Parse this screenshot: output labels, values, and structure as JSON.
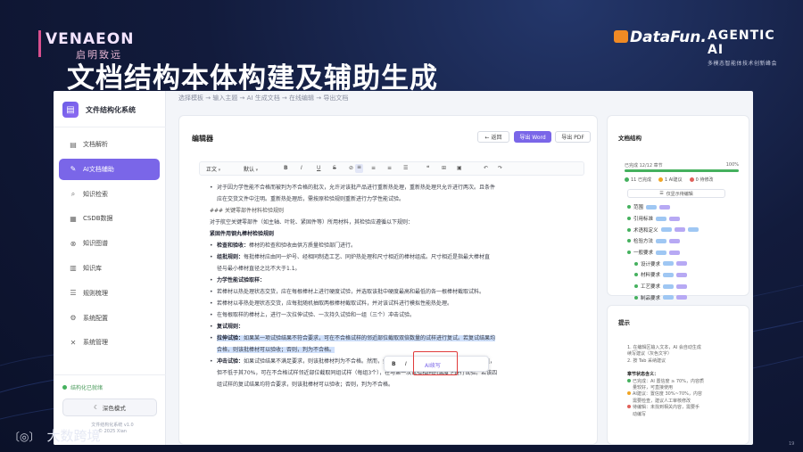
{
  "slide": {
    "brand_left_logo": "VENAEON",
    "brand_left_slogan": "启明致远",
    "brand_df": "DataFun.",
    "brand_agentic": "AGENTIC AI",
    "brand_agentic_sub": "多模态智能体技术创新峰会",
    "title": "文档结构本体构建及辅助生成",
    "bottom_logo": "大数跨境",
    "page_number": "19"
  },
  "app": {
    "breadcrumb": "选择模板 → 输入主题 → AI 生成文档 → 在线编辑 → 导出文档",
    "name": "文件结构化系统",
    "nav": [
      {
        "label": "文档解析",
        "icon": "document-icon"
      },
      {
        "label": "AI文档辅助",
        "icon": "ai-edit-icon"
      },
      {
        "label": "知识检索",
        "icon": "search-icon"
      },
      {
        "label": "CSDB数据",
        "icon": "database-icon"
      },
      {
        "label": "知识图谱",
        "icon": "graph-icon"
      },
      {
        "label": "知识库",
        "icon": "book-icon"
      },
      {
        "label": "规则梳理",
        "icon": "rules-icon"
      },
      {
        "label": "系统配置",
        "icon": "settings-icon"
      },
      {
        "label": "系统管理",
        "icon": "tools-icon"
      }
    ],
    "status": "结构化已就绪",
    "dark_mode": "深色模式",
    "version_line1": "文件结构化系统 v1.0",
    "version_line2": "© 2025 Xian"
  },
  "editor": {
    "title": "编辑器",
    "back": "← 返回",
    "export_word": "导出 Word",
    "export_pdf": "导出 PDF",
    "toolbar": {
      "style": "正文",
      "font": "默认",
      "bold": "B",
      "italic": "I",
      "underline": "U",
      "strike": "S",
      "link": "⊘",
      "align_left": "≡",
      "align_center": "≡",
      "align_right": "≡",
      "list": "☰",
      "quote": "❝",
      "table": "⊞",
      "image": "▣",
      "undo": "↶",
      "redo": "↷"
    },
    "lines": [
      {
        "t": "对于因力学性能不合格而被判为不合格的批次，允许对该批产品进行重新热处理，重新热处理只允许进行两次。且条件",
        "k": "bullet"
      },
      {
        "t": "应在交货文件中注明。重新热处理后，需按原检验规则重新进行力学性能试验。",
        "k": "cont"
      },
      {
        "t": "### 关键零部件材料检验规则",
        "k": "mono"
      },
      {
        "t": "对于航空关键零部件（如主轴、叶轮、紧固件等）所用材料，其检验应遵循以下规则：",
        "k": "plain"
      },
      {
        "t": "紧固件用钢丸棒材检验规则",
        "k": "head"
      },
      {
        "t": "检查和验收：棒材的检查和验收由供方质量检验部门进行。",
        "k": "bullet",
        "b": "检查和验收："
      },
      {
        "t": "组批规则：每批棒材应由同一炉号、经相同制造工艺、同炉热处理和尺寸相近的棒材组成。尺寸相近是指最大棒材直",
        "k": "bullet",
        "b": "组批规则："
      },
      {
        "t": "径与最小棒材直径之比不大于1.1。",
        "k": "cont"
      },
      {
        "t": "力学性能试验取样：",
        "k": "bullet",
        "b": "力学性能试验取样："
      },
      {
        "t": "若棒材以热处理状态交货，应在每根棒材上进行硬度试验，并选取该批中硬度最高和最低的各一根棒材截取试料。",
        "k": "bullet"
      },
      {
        "t": "若棒材以非热处理状态交货，应每批随机抽取两根棒材截取试料，并对该试料进行模拟性能热处理。",
        "k": "bullet"
      },
      {
        "t": "在每根取样的棒材上，进行一次拉伸试验、一次持久试验和一组（三个）冲击试验。",
        "k": "bullet"
      },
      {
        "t": "复试规则：",
        "k": "bullet",
        "b": "复试规则："
      },
      {
        "t": "拉伸试验：如果某一项试验结果不符合要求，可在不合格试样的邻近部位截取双倍数量的试样进行复试。若复试结果均",
        "k": "bullet hl",
        "b": "拉伸试验："
      },
      {
        "t": "合格，则该批棒材可以验收；否则，判为不合格。",
        "k": "cont hl"
      },
      {
        "t": "冲击试验：如果试验结果不满足要求，则该批棒材判为不合格。然而，如果仅有一个试样的试验结果低于最小规定值，",
        "k": "bullet",
        "b": "冲击试验："
      },
      {
        "t": "但不低于其70%，可在不合格试样邻近部位截取同组试样（每组3个），在与第一次试验相同的温度下进行试验。若该四",
        "k": "cont"
      },
      {
        "t": "组试样的复试结果均符合要求，则该批棒材可以验收；否则，判为不合格。",
        "k": "cont"
      }
    ],
    "float_toolbar": {
      "bold": "B",
      "italic": "I",
      "ai": "AI续写"
    }
  },
  "structure": {
    "title": "文档结构",
    "progress_label": "已完成 12/12 章节",
    "progress_pct": "100%",
    "progress_value": 1.0,
    "legend": [
      {
        "label": "11 已完成",
        "color": "#45b15e"
      },
      {
        "label": "1 AI建议",
        "color": "#f0a524"
      },
      {
        "label": "0 待修改",
        "color": "#e0605a"
      }
    ],
    "btn": "仅显示待编辑",
    "tree": [
      {
        "label": "范围",
        "indent": 0,
        "tags": [
          "b",
          "p"
        ]
      },
      {
        "label": "引用标准",
        "indent": 0,
        "tags": [
          "b",
          "p"
        ]
      },
      {
        "label": "术语和定义",
        "indent": 0,
        "tags": [
          "b",
          "p",
          "b"
        ]
      },
      {
        "label": "检验方法",
        "indent": 0,
        "tags": [
          "b",
          "p"
        ]
      },
      {
        "label": "一般要求",
        "indent": 0,
        "tags": [
          "b",
          "p"
        ]
      },
      {
        "label": "设计要求",
        "indent": 1,
        "tags": [
          "b",
          "p"
        ]
      },
      {
        "label": "材料要求",
        "indent": 1,
        "tags": [
          "b",
          "p"
        ]
      },
      {
        "label": "工艺要求",
        "indent": 1,
        "tags": [
          "b",
          "p"
        ]
      },
      {
        "label": "制品要求",
        "indent": 1,
        "tags": [
          "b",
          "p"
        ]
      }
    ]
  },
  "tips": {
    "title": "提示",
    "lines": [
      "1. 在编辑区输入文本，AI 会自动生成",
      "续写建议（灰色文字）",
      "2. 按 Tab 采纳建议"
    ],
    "status_title": "章节状态含义：",
    "status": [
      {
        "label": "已完成：AI 置信度 ≥ 70%，内容质",
        "cont": "量较好，可直接使用",
        "color": "#45b15e"
      },
      {
        "label": "AI建议：置信度 30%~70%，内容",
        "cont": "需要检查，建议人工审核修改",
        "color": "#f0a524"
      },
      {
        "label": "待编辑：未找到相关内容，需要手",
        "cont": "动编写",
        "color": "#e0605a"
      }
    ]
  }
}
